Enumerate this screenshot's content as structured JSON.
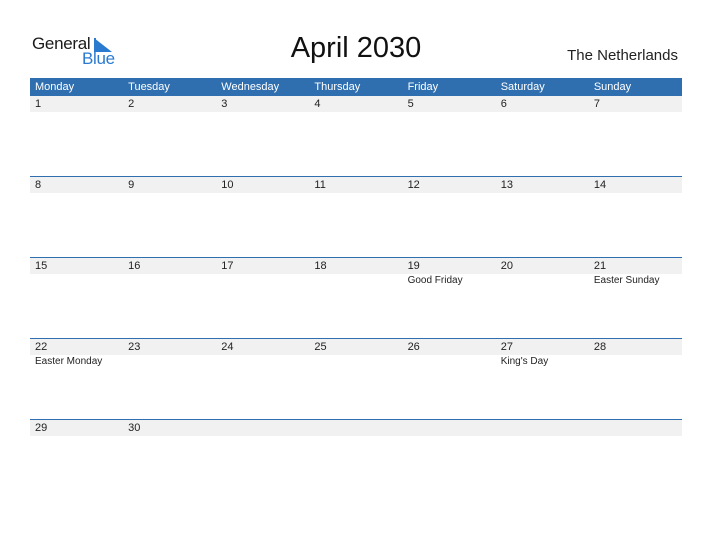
{
  "logo": {
    "general": "General",
    "blue": "Blue"
  },
  "title": "April 2030",
  "country": "The Netherlands",
  "weekdays": [
    "Monday",
    "Tuesday",
    "Wednesday",
    "Thursday",
    "Friday",
    "Saturday",
    "Sunday"
  ],
  "weeks": [
    {
      "days": [
        "1",
        "2",
        "3",
        "4",
        "5",
        "6",
        "7"
      ],
      "events": [
        "",
        "",
        "",
        "",
        "",
        "",
        ""
      ]
    },
    {
      "days": [
        "8",
        "9",
        "10",
        "11",
        "12",
        "13",
        "14"
      ],
      "events": [
        "",
        "",
        "",
        "",
        "",
        "",
        ""
      ]
    },
    {
      "days": [
        "15",
        "16",
        "17",
        "18",
        "19",
        "20",
        "21"
      ],
      "events": [
        "",
        "",
        "",
        "",
        "Good Friday",
        "",
        "Easter Sunday"
      ]
    },
    {
      "days": [
        "22",
        "23",
        "24",
        "25",
        "26",
        "27",
        "28"
      ],
      "events": [
        "Easter Monday",
        "",
        "",
        "",
        "",
        "King's Day",
        ""
      ]
    },
    {
      "days": [
        "29",
        "30",
        "",
        "",
        "",
        "",
        ""
      ],
      "events": [
        "",
        "",
        "",
        "",
        "",
        "",
        ""
      ]
    }
  ],
  "colors": {
    "accent": "#2f6fb0",
    "logo_blue": "#2a7ad0",
    "day_row_bg": "#f1f1f1"
  }
}
